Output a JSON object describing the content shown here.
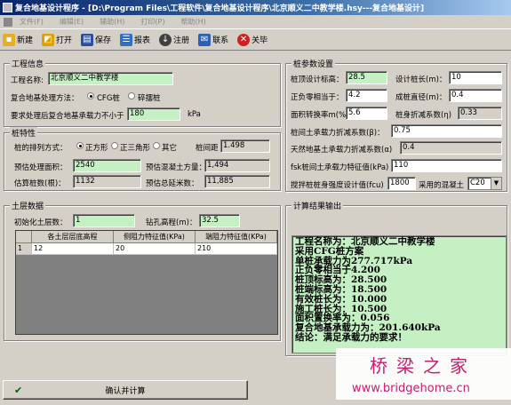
{
  "window": {
    "title": "复合地基设计程序 - [D:\\Program Files\\工程软件\\复合地基设计程序\\北京顺义二中教学楼.hsy---复合地基设计]"
  },
  "menu": [
    "文件(F)",
    "编辑(E)",
    "辅助(H)",
    "打印(P)",
    "帮助(H)"
  ],
  "toolbar": {
    "new": "新建",
    "open": "打开",
    "save": "保存",
    "report": "报表",
    "register": "注册",
    "contact": "联系",
    "close": "关毕"
  },
  "project_info": {
    "group_label": "工程信息",
    "name_label": "工程名称:",
    "name_value": "北京顺义二中教学楼",
    "method_label": "复合地基处理方法：",
    "opt_cfg": "CFG桩",
    "opt_gravel": "碎摆桩",
    "bearing_label": "要求处理后复合地基承载力不小于",
    "bearing_value": "180",
    "bearing_unit": "kPa"
  },
  "pile_props": {
    "group_label": "桩特性",
    "layout_label": "桩的排列方式：",
    "opt_square": "正方形",
    "opt_triangle": "正三角形",
    "opt_other": "其它",
    "spacing_label": "桩间距",
    "spacing_value": "1.498",
    "area_label": "预估处理面积：",
    "area_value": "2540",
    "volume_label": "预估混凝土方量：",
    "volume_value": "1,494",
    "count_label": "估算桩数(根)：",
    "count_value": "1132",
    "length_label": "预估总延米数：",
    "length_value": "11,885"
  },
  "soil": {
    "group_label": "土层数据",
    "layers_label": "初始化土层数：",
    "layers_value": "1",
    "elev_label": "钻孔高程(m)：",
    "elev_value": "32.5",
    "columns": [
      "各土层层底高程",
      "侧阻力特征值(KPa)",
      "端阻力特征值(KPa)"
    ],
    "rows": [
      {
        "idx": "1",
        "elev": "12",
        "side": "20",
        "end": "210"
      }
    ]
  },
  "params": {
    "group_label": "桩参数设置",
    "top_label": "桩顶设计标高：",
    "top_value": "28.5",
    "len_label": "设计桩长(m)：",
    "len_value": "10",
    "neg_label": "正负零相当于：",
    "neg_value": "4.2",
    "dia_label": "成桩直径(m)：",
    "dia_value": "0.4",
    "area_label": "面积转换率m(%)",
    "area_value": "5.6",
    "eta_label": "桩身折减系数(η)",
    "eta_value": "0.33",
    "beta_label": "桩间土承载力折减系数(β)：",
    "beta_value": "0.75",
    "natural_label": "天然地基土承载力折减系数(α)",
    "natural_value": "0.4",
    "fsk_label": "fsk桩间土承载力特征值(kPa)",
    "fsk_value": "110",
    "fcu_label": "搅拌桩桩身强度设计值(fcu)",
    "fcu_value": "1800",
    "concrete_label": "采用的混凝土",
    "concrete_value": "C20"
  },
  "output": {
    "group_label": "计算结果输出",
    "text": "工程名称为：北京顺义二中教学楼\n采用CFG桩方案\n单桩承载力为277.717kPa\n正负零相当于4.200\n桩顶标高为：28.500\n桩端标高为：18.500\n有效桩长为：10.000\n施工桩长为：10.500\n面积置换率为：0.056\n复合地基承载力为：201.640kPa\n结论：满足承载力的要求！"
  },
  "actions": {
    "calc": "确认并计算"
  },
  "watermark": {
    "cn": "桥梁之家",
    "url": "www.bridgehome.cn"
  }
}
